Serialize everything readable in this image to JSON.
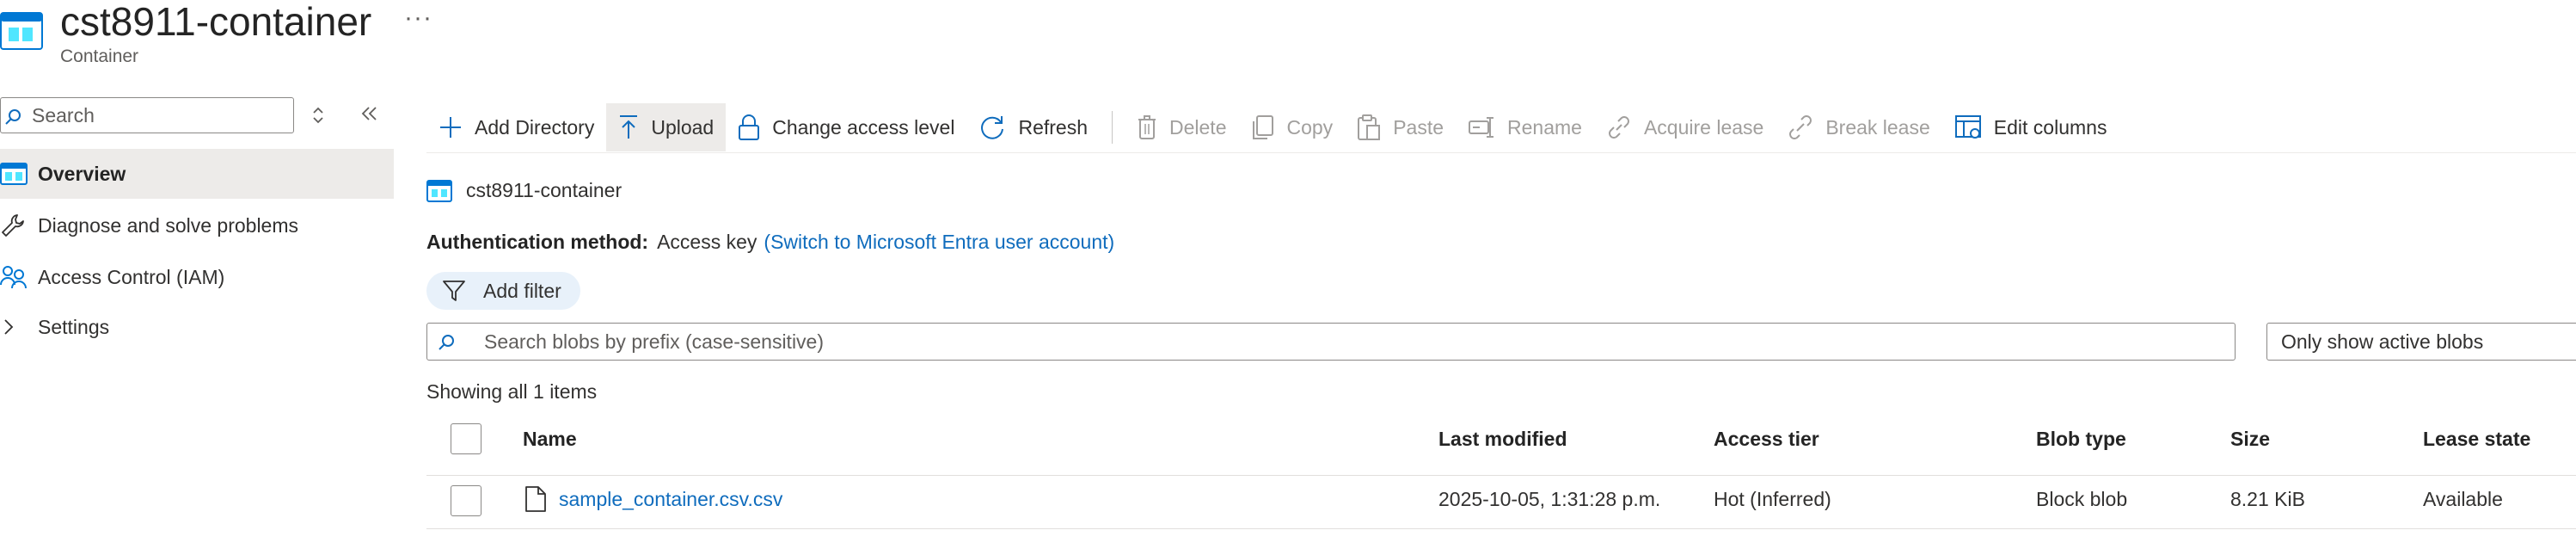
{
  "header": {
    "title": "cst8911-container",
    "subtitle": "Container",
    "more_label": "···",
    "icon": "container-icon"
  },
  "nav": {
    "search_placeholder": "Search",
    "items": [
      {
        "label": "Overview",
        "icon": "overview-icon",
        "active": true
      },
      {
        "label": "Diagnose and solve problems",
        "icon": "wrench-icon"
      },
      {
        "label": "Access Control (IAM)",
        "icon": "people-icon"
      },
      {
        "label": "Settings",
        "icon": "chevron-right-icon"
      }
    ]
  },
  "toolbar": {
    "add_directory": "Add Directory",
    "upload": "Upload",
    "change_access": "Change access level",
    "refresh": "Refresh",
    "delete": "Delete",
    "copy": "Copy",
    "paste": "Paste",
    "rename": "Rename",
    "acquire_lease": "Acquire lease",
    "break_lease": "Break lease",
    "edit_columns": "Edit columns"
  },
  "breadcrumb": {
    "label": "cst8911-container"
  },
  "auth": {
    "key": "Authentication method:",
    "value": "Access key",
    "link": "(Switch to Microsoft Entra user account)"
  },
  "filter": {
    "label": "Add filter"
  },
  "blob_search": {
    "placeholder": "Search blobs by prefix (case-sensitive)"
  },
  "active_filter": {
    "value": "Only show active blobs"
  },
  "summary": {
    "count_text": "Showing all 1 items"
  },
  "table": {
    "columns": [
      "Name",
      "Last modified",
      "Access tier",
      "Blob type",
      "Size",
      "Lease state"
    ],
    "rows": [
      {
        "name": "sample_container.csv.csv",
        "last_modified": "2025-10-05, 1:31:28 p.m.",
        "access_tier": "Hot (Inferred)",
        "blob_type": "Block blob",
        "size": "8.21 KiB",
        "lease_state": "Available"
      }
    ]
  },
  "colors": {
    "accent": "#0f6cbd",
    "selected_bg": "#edebe9",
    "pill_bg": "#e8f1fa",
    "disabled": "#a19f9d"
  }
}
